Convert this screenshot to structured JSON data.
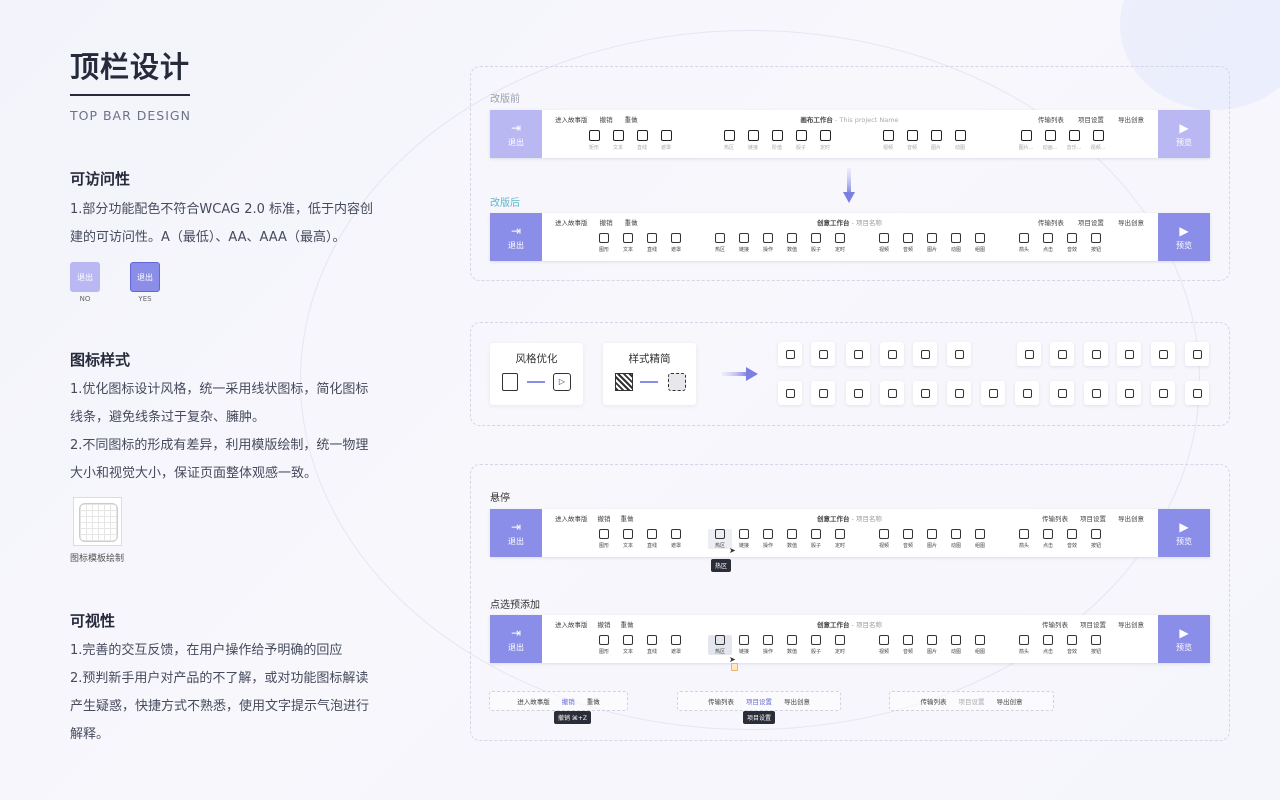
{
  "colors": {
    "accent": "#8b8ee8",
    "accent_light": "#b9b8f3",
    "hover_tip": "#2b2d38",
    "old_label": "#9aa0b0",
    "new_label": "#5fb8c8"
  },
  "left": {
    "title": "顶栏设计",
    "subtitle": "TOP BAR DESIGN",
    "accessibility": {
      "heading": "可访问性",
      "lines": [
        "1.部分功能配色不符合WCAG 2.0 标准，低于内容创",
        "建的可访问性。A（最低）、AA、AAA（最高）。"
      ],
      "no_btn": "退出",
      "no_cap": "NO",
      "yes_btn": "退出",
      "yes_cap": "YES"
    },
    "icon_style": {
      "heading": "图标样式",
      "lines": [
        "1.优化图标设计风格，统一采用线状图标，简化图标",
        "线条，避免线条过于复杂、臃肿。",
        "2.不同图标的形成有差异，利用模版绘制，统一物理",
        "大小和视觉大小，保证页面整体观感一致。"
      ],
      "template_caption": "图标模板绘制"
    },
    "visibility": {
      "heading": "可视性",
      "lines": [
        "1.完善的交互反馈，在用户操作给予明确的回应",
        "2.预判新手用户对产品的不了解，或对功能图标解读",
        "产生疑惑，快捷方式不熟悉，使用文字提示气泡进行",
        "解释。"
      ]
    }
  },
  "panel1": {
    "before_label": "改版前",
    "after_label": "改版后"
  },
  "bar_old": {
    "exit": "退出",
    "preview": "预览",
    "left_actions": [
      "进入故事版",
      "撤销",
      "重做"
    ],
    "center_title": "画布工作台",
    "center_sub": " - This project Name",
    "right_actions": [
      "传输列表",
      "项目设置",
      "导出创意"
    ],
    "groups": [
      [
        "矩形",
        "文本",
        "直线",
        "遮罩"
      ],
      [
        "热区",
        "链接",
        "阶值",
        "骰子",
        "定时"
      ],
      [
        "视频",
        "音频",
        "图片",
        "动图"
      ],
      [
        "图片...",
        "动画...",
        "音乐...",
        "视频..."
      ]
    ]
  },
  "bar_new": {
    "exit": "退出",
    "preview": "预览",
    "left_actions": [
      "进入故事版",
      "撤销",
      "重做"
    ],
    "center_title": "创意工作台",
    "center_sub": " - 项目名称",
    "right_actions": [
      "传输列表",
      "项目设置",
      "导出创意"
    ],
    "groups": [
      [
        "图形",
        "文本",
        "直线",
        "遮罩"
      ],
      [
        "热区",
        "链接",
        "操作",
        "数值",
        "骰子",
        "定时"
      ],
      [
        "视频",
        "音频",
        "图片",
        "动图",
        "组图"
      ],
      [
        "箭头",
        "点击",
        "音效",
        "按钮"
      ]
    ]
  },
  "panel2": {
    "card1_title": "风格优化",
    "card2_title": "样式精简",
    "row1_icons": [
      "story-icon",
      "undo-icon",
      "redo-icon",
      "transfer-icon",
      "settings-icon",
      "export-icon",
      "shape-icon",
      "text-icon",
      "line-icon",
      "mask-icon",
      "hotspot-icon",
      "link-icon"
    ],
    "row2_icons": [
      "operation-icon",
      "value-icon",
      "dice-icon",
      "timer-icon",
      "video-icon",
      "audio-icon",
      "image-icon",
      "gif-icon",
      "gallery-icon",
      "arrow-icon",
      "click-icon",
      "sound-icon",
      "button-icon"
    ]
  },
  "panel3": {
    "hover_label": "悬停",
    "click_label": "点选预添加",
    "hover_tip": "热区",
    "mini1": [
      "进入故事版",
      "撤销",
      "重做"
    ],
    "mini1_tip": "撤销 ⌘+Z",
    "mini2": [
      "传输列表",
      "项目设置",
      "导出创意"
    ],
    "mini2_tip": "项目设置",
    "mini3": [
      "传输列表",
      "项目设置",
      "导出创意"
    ]
  }
}
